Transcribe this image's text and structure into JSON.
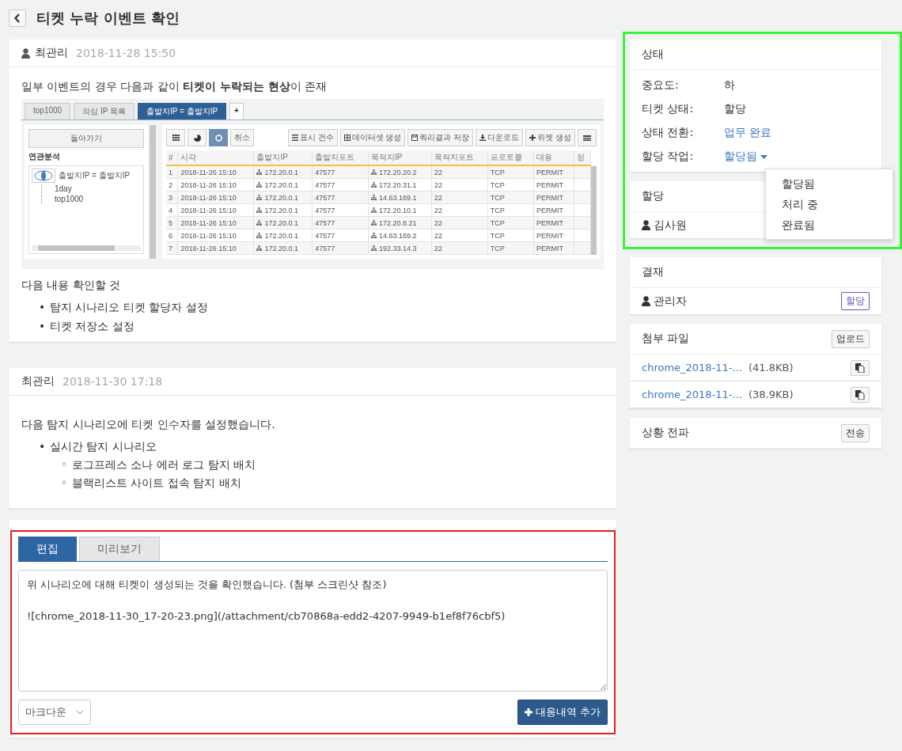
{
  "page": {
    "title": "티켓 누락 이벤트 확인"
  },
  "comments": [
    {
      "avatar": true,
      "author": "최관리",
      "time": "2018-11-28 15:50",
      "blocks": [
        {
          "kind": "paragraph",
          "text": "일부 이벤트의 경우 다음과 같이 **티켓이 누락되는 현상**이 존재"
        },
        {
          "kind": "screenshot",
          "tabs": [
            {
              "label": "top1000",
              "selected": false
            },
            {
              "label": "의심 IP 목록",
              "selected": false
            },
            {
              "label": "출발지IP = 출발지IP",
              "selected": true
            }
          ],
          "add_tab": "+",
          "back": "돌아가기",
          "section": "연관분석",
          "tree": {
            "label": "출발지IP = 출발지IP",
            "children": [
              {
                "label": "1day"
              },
              {
                "label": "top1000"
              }
            ]
          },
          "view_buttons": [
            {
              "kind": "grid",
              "selected": false
            },
            {
              "kind": "pie",
              "selected": false
            },
            {
              "kind": "ring",
              "selected": true
            }
          ],
          "cancel": "취소",
          "actions": [
            {
              "kind": "list",
              "label": "표시 건수"
            },
            {
              "kind": "table",
              "label": "데이터셋 생성"
            },
            {
              "kind": "save",
              "label": "쿼리결과 저장"
            },
            {
              "kind": "download",
              "label": "다운로드"
            },
            {
              "kind": "plus",
              "label": "위젯 생성"
            }
          ],
          "columns": [
            "#",
            "시각",
            "출발지IP",
            "출발지포트",
            "목적지IP",
            "목적지포트",
            "프로토콜",
            "대응",
            "정"
          ],
          "rows": [
            [
              "1",
              "2018-11-26 15:10",
              "172.20.0.1",
              "47577",
              "172.20.20.2",
              "22",
              "TCP",
              "PERMIT"
            ],
            [
              "2",
              "2018-11-26 15:10",
              "172.20.0.1",
              "47577",
              "172.20.31.1",
              "22",
              "TCP",
              "PERMIT"
            ],
            [
              "3",
              "2018-11-26 15:10",
              "172.20.0.1",
              "47577",
              "14.63.169.1",
              "22",
              "TCP",
              "PERMIT"
            ],
            [
              "4",
              "2018-11-26 15:10",
              "172.20.0.1",
              "47577",
              "172.20.10.1",
              "22",
              "TCP",
              "PERMIT"
            ],
            [
              "5",
              "2018-11-26 15:10",
              "172.20.0.1",
              "47577",
              "172.20.8.21",
              "22",
              "TCP",
              "PERMIT"
            ],
            [
              "6",
              "2018-11-26 15:10",
              "172.20.0.1",
              "47577",
              "14.63.169.2",
              "22",
              "TCP",
              "PERMIT"
            ],
            [
              "7",
              "2018-11-26 15:10",
              "172.20.0.1",
              "47577",
              "192.33.14.3",
              "22",
              "TCP",
              "PERMIT"
            ]
          ]
        },
        {
          "kind": "paragraph",
          "text": "다음 내용 확인할 것"
        },
        {
          "kind": "list",
          "items": [
            {
              "marker": "•",
              "text": "탐지 시나리오 티켓 할당자 설정"
            },
            {
              "marker": "•",
              "text": "티켓 저장소 설정"
            }
          ]
        }
      ]
    },
    {
      "avatar": false,
      "author": "최관리",
      "time": "2018-11-30 17:18",
      "blocks": [
        {
          "kind": "paragraph",
          "text": "다음 탐지 시나리오에 티켓 인수자를 설정했습니다."
        },
        {
          "kind": "list",
          "items": [
            {
              "marker": "•",
              "text": "실시간 탐지 시나리오",
              "children": [
                {
                  "marker": "◦",
                  "text": "로그프레스 소나 에러 로그 탐지 배치"
                },
                {
                  "marker": "◦",
                  "text": "블랙리스트 사이트 접속 탐지 배치"
                }
              ]
            }
          ]
        }
      ]
    }
  ],
  "editor": {
    "tabs": [
      {
        "label": "편집",
        "selected": true
      },
      {
        "label": "미리보기",
        "selected": false
      }
    ],
    "value": "위 시나리오에 대해 티켓이 생성되는 것을 확인했습니다. (첨부 스크린샷 참조)\n\n![chrome_2018-11-30_17-20-23.png](/attachment/cb70868a-edd2-4207-9949-b1ef8f76cbf5)",
    "format": "마크다운",
    "submit": "대응내역 추가"
  },
  "status": {
    "title": "상태",
    "fields": [
      {
        "kind": "text",
        "label": "중요도:",
        "value": "하"
      },
      {
        "kind": "text",
        "label": "티켓 상태:",
        "value": "할당"
      },
      {
        "kind": "link",
        "label": "상태 전환:",
        "value": "업무 완료"
      },
      {
        "kind": "dropdown",
        "label": "할당 작업:",
        "value": "할당됨",
        "expanded": true,
        "options": [
          "할당됨",
          "처리 중",
          "완료됨"
        ]
      }
    ]
  },
  "assignee": {
    "title": "할당",
    "person": "김사원"
  },
  "approval": {
    "title": "결재",
    "person": "관리자",
    "button": "할당"
  },
  "attachments": {
    "title": "첨부 파일",
    "button": "업로드",
    "files": [
      {
        "name": "chrome_2018-11-...",
        "size": "(41.8KB)"
      },
      {
        "name": "chrome_2018-11-...",
        "size": "(38.9KB)"
      }
    ]
  },
  "escalation": {
    "title": "상황 전파",
    "button": "전송"
  }
}
